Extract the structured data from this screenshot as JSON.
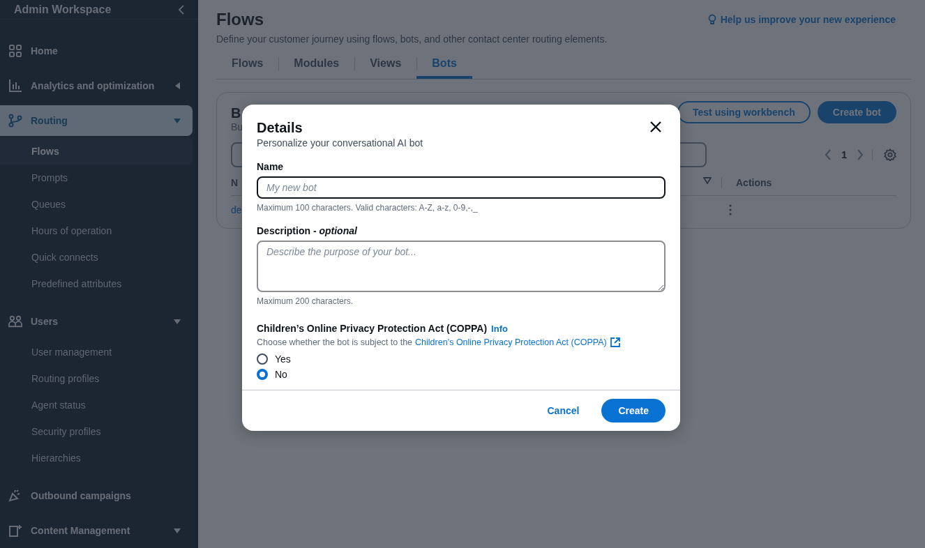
{
  "sidebar": {
    "title": "Admin Workspace",
    "items": [
      {
        "label": "Home",
        "selected": false
      },
      {
        "label": "Analytics and optimization",
        "selected": false,
        "expanded": false
      },
      {
        "label": "Routing",
        "selected": true,
        "expanded": true,
        "children": [
          {
            "label": "Flows",
            "selected": true
          },
          {
            "label": "Prompts",
            "selected": false
          },
          {
            "label": "Queues",
            "selected": false
          },
          {
            "label": "Hours of operation",
            "selected": false
          },
          {
            "label": "Quick connects",
            "selected": false
          },
          {
            "label": "Predefined attributes",
            "selected": false
          }
        ]
      },
      {
        "label": "Users",
        "selected": false,
        "expanded": true,
        "children": [
          {
            "label": "User management",
            "selected": false
          },
          {
            "label": "Routing profiles",
            "selected": false
          },
          {
            "label": "Agent status",
            "selected": false
          },
          {
            "label": "Security profiles",
            "selected": false
          },
          {
            "label": "Hierarchies",
            "selected": false
          }
        ]
      },
      {
        "label": "Outbound campaigns",
        "selected": false
      },
      {
        "label": "Content Management",
        "selected": false,
        "expanded": true
      }
    ]
  },
  "header": {
    "title": "Flows",
    "description": "Define your customer journey using flows, bots, and other contact center routing elements.",
    "feedback_link": "Help us improve your new experience"
  },
  "tabs": [
    {
      "label": "Flows",
      "selected": false
    },
    {
      "label": "Modules",
      "selected": false
    },
    {
      "label": "Views",
      "selected": false
    },
    {
      "label": "Bots",
      "selected": true
    }
  ],
  "bots_panel": {
    "heading": "B",
    "subtitle": "Bu",
    "buttons": [
      "Test using workbench",
      "Create bot"
    ],
    "page": "1",
    "columns": [
      "N",
      "Actions"
    ],
    "rows": [
      {
        "name": "de"
      }
    ]
  },
  "modal": {
    "title": "Details",
    "subtitle": "Personalize your conversational AI bot",
    "name_field": {
      "label": "Name",
      "placeholder": "My new bot",
      "hint": "Maximum 100 characters. Valid characters: A-Z, a-z, 0-9,-,_"
    },
    "description_field": {
      "label": "Description - *optional*",
      "placeholder": "Describe the purpose of your bot...",
      "hint": "Maximum 200 characters."
    },
    "coppa": {
      "label": "Children’s Online Privacy Protection Act (COPPA)",
      "info": "Info",
      "description": "Choose whether the bot is subject to the",
      "link": "Children’s Online Privacy Protection Act (COPPA)",
      "options": [
        {
          "label": "Yes",
          "selected": false
        },
        {
          "label": "No",
          "selected": true
        }
      ]
    },
    "buttons": {
      "cancel": "Cancel",
      "confirm": "Create"
    }
  }
}
